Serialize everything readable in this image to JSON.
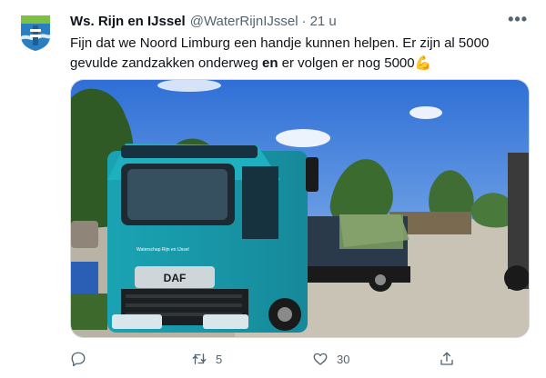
{
  "tweet": {
    "display_name": "Ws. Rijn en IJssel",
    "handle": "@WaterRijnIJssel",
    "separator": "·",
    "time": "21 u",
    "more_label": "•••",
    "text_part1": "Fijn dat we Noord Limburg een handje kunnen helpen. Er zijn al 5000 gevulde zandzakken onderweg ",
    "text_bold": "en",
    "text_part2": " er volgen er nog 5000",
    "emoji": "💪",
    "truck_brand": "DAF",
    "truck_logo_text": "Waterschap Rijn en IJssel",
    "avatar_icon": "waterschap-shield-logo",
    "actions": {
      "reply_count": "",
      "retweet_count": "5",
      "like_count": "30",
      "share_count": ""
    }
  }
}
